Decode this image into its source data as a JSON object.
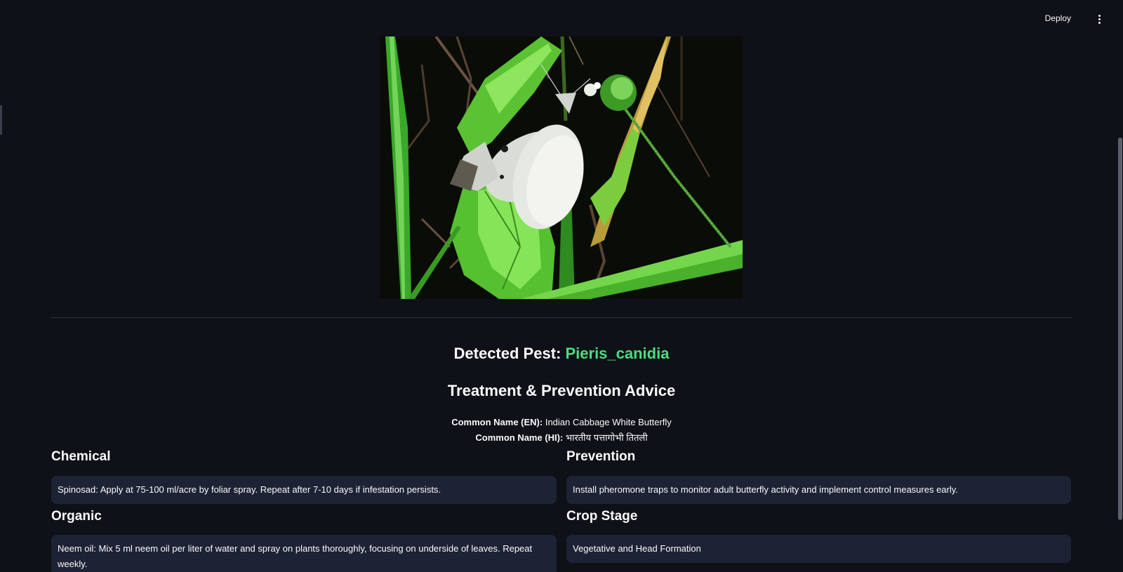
{
  "header": {
    "deploy_label": "Deploy",
    "menu_icon": "kebab-menu-icon"
  },
  "image": {
    "alt": "Pieris_canidia"
  },
  "result": {
    "prefix": "Detected Pest:",
    "pest_name": "Pieris_canidia",
    "pest_color": "#4ade80"
  },
  "advice": {
    "title": "Treatment & Prevention Advice",
    "common_name_en_label": "Common Name (EN):",
    "common_name_en_value": "Indian Cabbage White Butterfly",
    "common_name_hi_label": "Common Name (HI):",
    "common_name_hi_value": "भारतीय पत्तागोभी तितली"
  },
  "sections": {
    "chemical": {
      "heading": "Chemical",
      "text": "Spinosad: Apply at 75-100 ml/acre by foliar spray. Repeat after 7-10 days if infestation persists."
    },
    "prevention": {
      "heading": "Prevention",
      "text": "Install pheromone traps to monitor adult butterfly activity and implement control measures early."
    },
    "organic": {
      "heading": "Organic",
      "text": "Neem oil: Mix 5 ml neem oil per liter of water and spray on plants thoroughly, focusing on underside of leaves. Repeat weekly."
    },
    "crop_stage": {
      "heading": "Crop Stage",
      "text": "Vegetative and Head Formation"
    }
  },
  "colors": {
    "background": "#0e1117",
    "card": "#1e2235",
    "accent": "#4ade80"
  }
}
